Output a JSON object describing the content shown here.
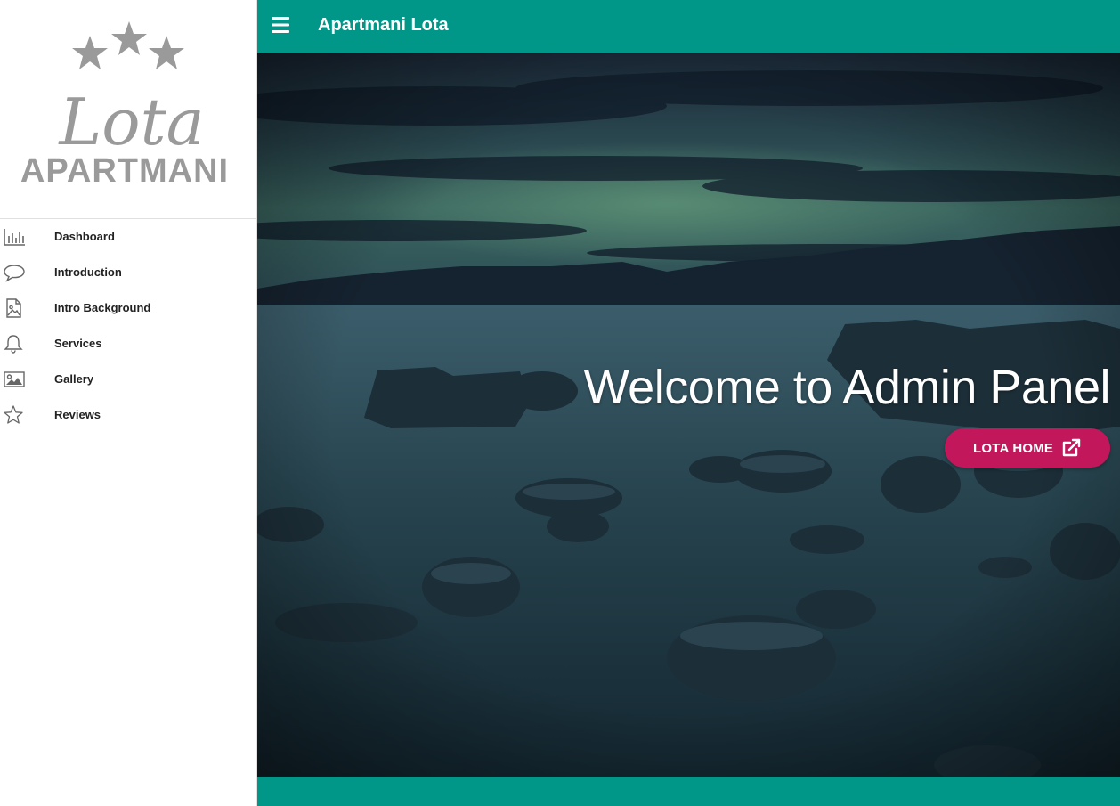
{
  "logo": {
    "script_text": "Lota",
    "block_text": "APARTMANI",
    "stars": 3
  },
  "sidebar": {
    "items": [
      {
        "label": "Dashboard",
        "icon": "bar-chart-icon"
      },
      {
        "label": "Introduction",
        "icon": "speech-bubble-icon"
      },
      {
        "label": "Intro Background",
        "icon": "image-file-icon"
      },
      {
        "label": "Services",
        "icon": "bell-icon"
      },
      {
        "label": "Gallery",
        "icon": "picture-icon"
      },
      {
        "label": "Reviews",
        "icon": "star-icon"
      }
    ]
  },
  "header": {
    "title": "Apartmani Lota",
    "menu_icon": "hamburger-menu-icon"
  },
  "hero": {
    "heading": "Welcome to Admin Panel",
    "button_label": "LOTA HOME",
    "button_icon": "external-link-icon"
  },
  "colors": {
    "accent": "#009688",
    "button": "#c2185b",
    "logo_gray": "#9e9e9e"
  }
}
